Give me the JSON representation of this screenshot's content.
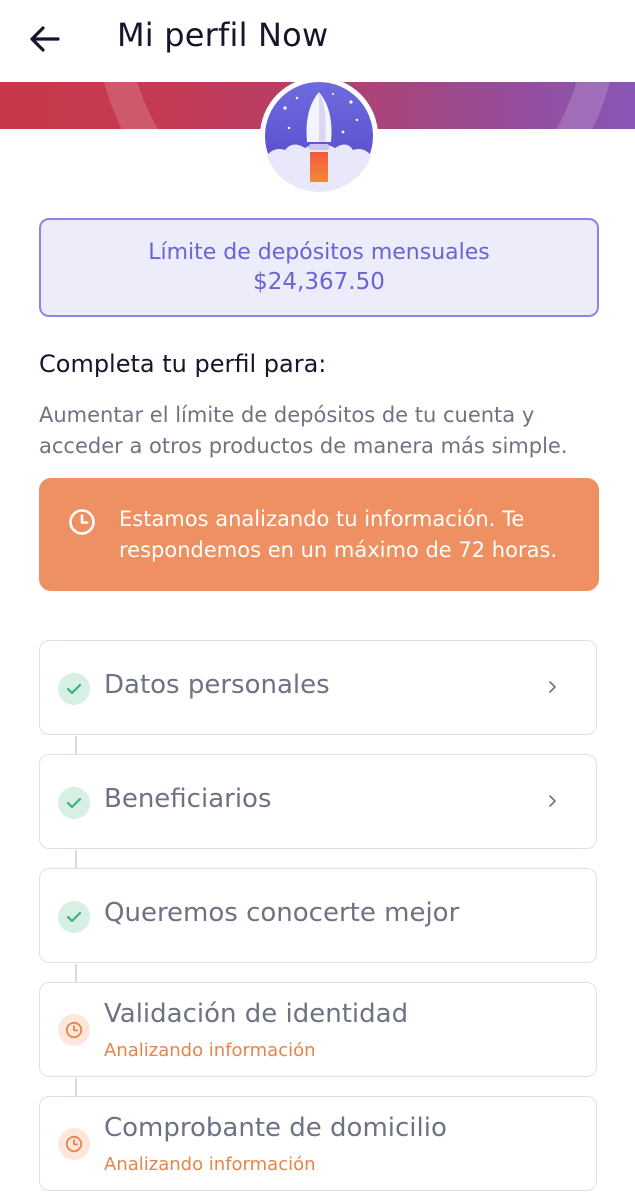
{
  "header": {
    "back_icon": "arrow-left-icon",
    "title": "Mi perfil Now"
  },
  "banner": {
    "avatar_icon": "rocket-icon",
    "gradient_start": "#c9384a",
    "gradient_end": "#8a55b8"
  },
  "limit": {
    "label": "Límite de depósitos mensuales",
    "value": "$24,367.50",
    "accent_color": "#6b63d6"
  },
  "profile": {
    "title": "Completa tu perfil para:",
    "description": "Aumentar el límite de depósitos de tu cuenta y acceder a otros productos de manera más simple."
  },
  "alert": {
    "icon": "clock-icon",
    "text": "Estamos analizando tu información. Te respondemos en un máximo de 72 horas.",
    "color": "#ef9063"
  },
  "steps": [
    {
      "label": "Datos personales",
      "state": "done",
      "icon": "check-icon",
      "has_chevron": true
    },
    {
      "label": "Beneficiarios",
      "state": "done",
      "icon": "check-icon",
      "has_chevron": true
    },
    {
      "label": "Queremos conocerte mejor",
      "state": "done",
      "icon": "check-icon",
      "has_chevron": false
    },
    {
      "label": "Validación de identidad",
      "state": "pending",
      "icon": "clock-icon",
      "status": "Analizando información",
      "has_chevron": false
    },
    {
      "label": "Comprobante de domicilio",
      "state": "pending",
      "icon": "clock-icon",
      "status": "Analizando información",
      "has_chevron": false
    }
  ],
  "colors": {
    "done": "#3fb07f",
    "pending": "#e8834a"
  }
}
